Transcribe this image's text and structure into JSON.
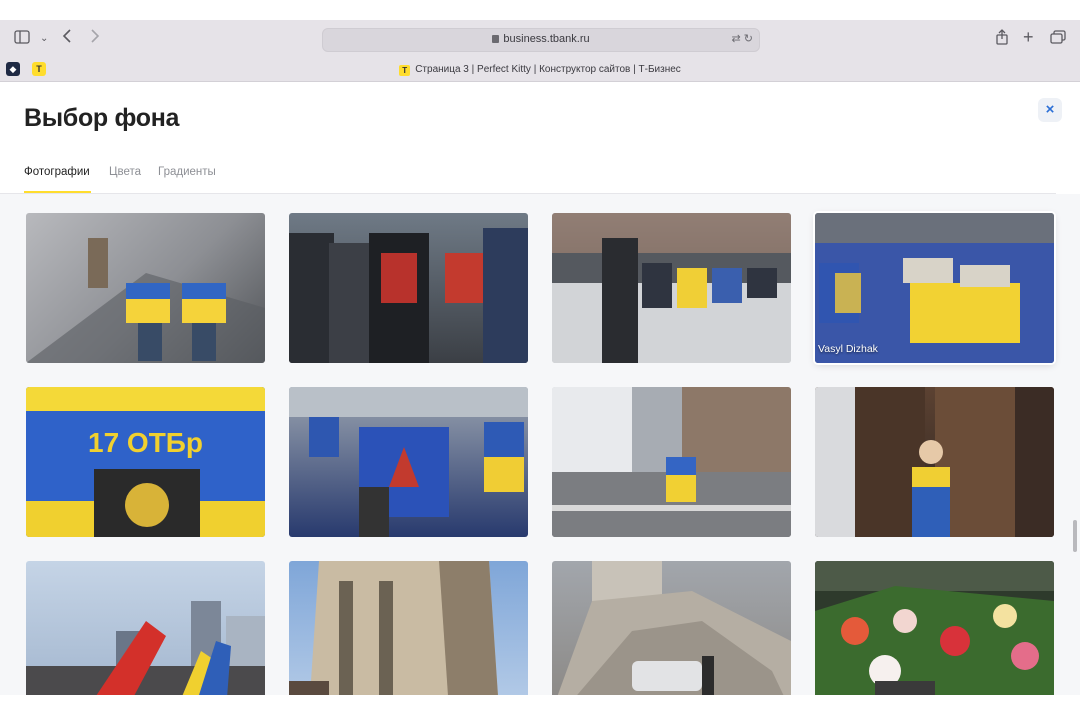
{
  "browser": {
    "url": "business.tbank.ru",
    "tab_title": "Страница 3 | Perfect Kitty | Конструктор сайтов | Т-Бизнес",
    "favicon_letter": "T"
  },
  "modal": {
    "title": "Выбор фона",
    "close_label": "×",
    "tabs": [
      {
        "label": "Фотографии",
        "active": true
      },
      {
        "label": "Цвета",
        "active": false
      },
      {
        "label": "Градиенты",
        "active": false
      }
    ]
  },
  "photos": [
    {
      "caption": ""
    },
    {
      "caption": ""
    },
    {
      "caption": ""
    },
    {
      "caption": "Vasyl Dizhak"
    },
    {
      "caption": ""
    },
    {
      "caption": ""
    },
    {
      "caption": ""
    },
    {
      "caption": ""
    },
    {
      "caption": ""
    },
    {
      "caption": ""
    },
    {
      "caption": ""
    },
    {
      "caption": ""
    }
  ],
  "colors": {
    "accent_yellow": "#ffdd2d",
    "close_blue": "#2b6fd6"
  }
}
